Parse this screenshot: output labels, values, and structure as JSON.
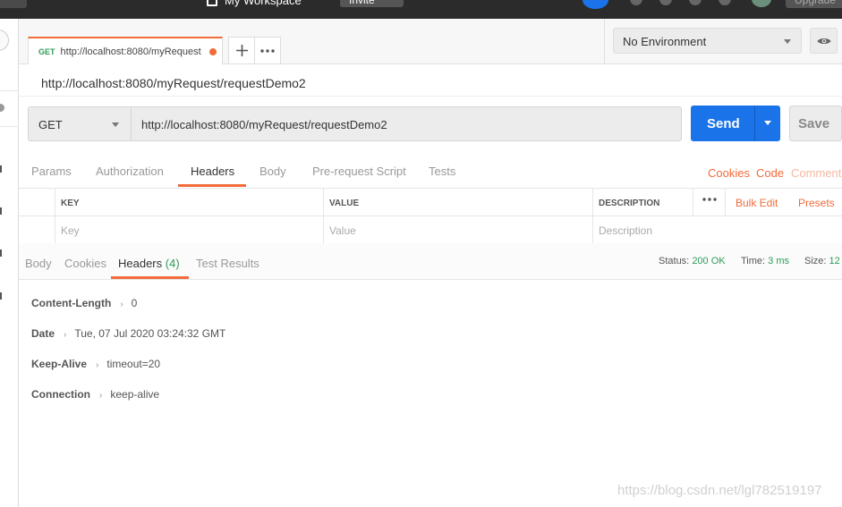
{
  "topbar": {
    "workspace_label": "My Workspace",
    "invite_label": "Invite",
    "upgrade_label": "Upgrade"
  },
  "tabs": {
    "active_tab": {
      "method": "GET",
      "label": "http://localhost:8080/myRequest"
    },
    "new_tab_icon": "plus-icon",
    "more_icon": "ellipsis-icon"
  },
  "environment": {
    "selected": "No Environment",
    "eye_icon": "eye-icon"
  },
  "request": {
    "name": "http://localhost:8080/myRequest/requestDemo2",
    "method": "GET",
    "url": "http://localhost:8080/myRequest/requestDemo2",
    "send_label": "Send",
    "save_label": "Save"
  },
  "request_tabs": {
    "items": [
      "Params",
      "Authorization",
      "Headers",
      "Body",
      "Pre-request Script",
      "Tests"
    ],
    "active": "Headers",
    "links": [
      "Cookies",
      "Code",
      "Comments"
    ]
  },
  "headers_table": {
    "columns": [
      "KEY",
      "VALUE",
      "DESCRIPTION"
    ],
    "bulk_edit_label": "Bulk Edit",
    "presets_label": "Presets",
    "placeholders": {
      "key": "Key",
      "value": "Value",
      "description": "Description"
    }
  },
  "response": {
    "tabs": [
      "Body",
      "Cookies",
      "Headers",
      "Test Results"
    ],
    "headers_count": "(4)",
    "active": "Headers",
    "status_label": "Status:",
    "status_value": "200 OK",
    "time_label": "Time:",
    "time_value": "3 ms",
    "size_label": "Size:",
    "size_value": "12",
    "headers": [
      {
        "key": "Content-Length",
        "value": "0"
      },
      {
        "key": "Date",
        "value": "Tue, 07 Jul 2020 03:24:32 GMT"
      },
      {
        "key": "Keep-Alive",
        "value": "timeout=20"
      },
      {
        "key": "Connection",
        "value": "keep-alive"
      }
    ]
  },
  "watermark": "https://blog.csdn.net/lgl782519197",
  "colors": {
    "accent": "#f26b3a",
    "send_blue": "#1a73e8",
    "method_green": "#2e9c5a"
  }
}
